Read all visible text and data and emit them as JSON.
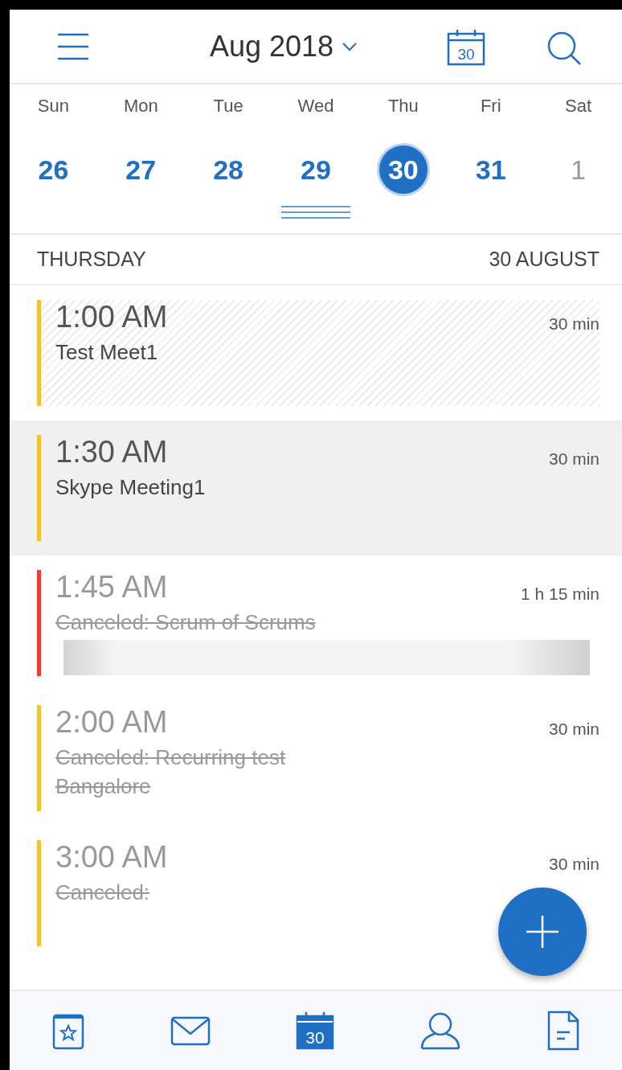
{
  "header": {
    "title": "Aug 2018",
    "today_icon_text": "30"
  },
  "week": [
    {
      "weekday": "Sun",
      "date": "26",
      "selected": false,
      "other_month": false
    },
    {
      "weekday": "Mon",
      "date": "27",
      "selected": false,
      "other_month": false
    },
    {
      "weekday": "Tue",
      "date": "28",
      "selected": false,
      "other_month": false
    },
    {
      "weekday": "Wed",
      "date": "29",
      "selected": false,
      "other_month": false
    },
    {
      "weekday": "Thu",
      "date": "30",
      "selected": true,
      "other_month": false
    },
    {
      "weekday": "Fri",
      "date": "31",
      "selected": false,
      "other_month": false
    },
    {
      "weekday": "Sat",
      "date": "1",
      "selected": false,
      "other_month": true
    }
  ],
  "day_header": {
    "weekday": "THURSDAY",
    "date": "30 AUGUST"
  },
  "events": [
    {
      "time": "1:00 AM",
      "title": "Test Meet1",
      "duration": "30 min",
      "color": "#f2c12e",
      "canceled": false,
      "tentative": true,
      "selected": false,
      "redacted": false
    },
    {
      "time": "1:30 AM",
      "title": "Skype Meeting1",
      "duration": "30 min",
      "color": "#f2c12e",
      "canceled": false,
      "tentative": false,
      "selected": true,
      "redacted": false
    },
    {
      "time": "1:45 AM",
      "title": "Canceled: Scrum of Scrums",
      "duration": "1 h 15 min",
      "color": "#ee3b3b",
      "canceled": true,
      "tentative": false,
      "selected": false,
      "redacted": true
    },
    {
      "time": "2:00 AM",
      "title": "Canceled: Recurring test Bangalore",
      "duration": "30 min",
      "color": "#f2c12e",
      "canceled": true,
      "tentative": false,
      "selected": false,
      "redacted": false
    },
    {
      "time": "3:00 AM",
      "title": "Canceled:",
      "duration": "30 min",
      "color": "#f2c12e",
      "canceled": true,
      "tentative": false,
      "selected": false,
      "redacted": false
    }
  ],
  "tabs": [
    {
      "kind": "favorites",
      "selected": false
    },
    {
      "kind": "mail",
      "selected": false
    },
    {
      "kind": "calendar",
      "selected": true,
      "icon_text": "30"
    },
    {
      "kind": "contacts",
      "selected": false
    },
    {
      "kind": "files",
      "selected": false
    }
  ]
}
